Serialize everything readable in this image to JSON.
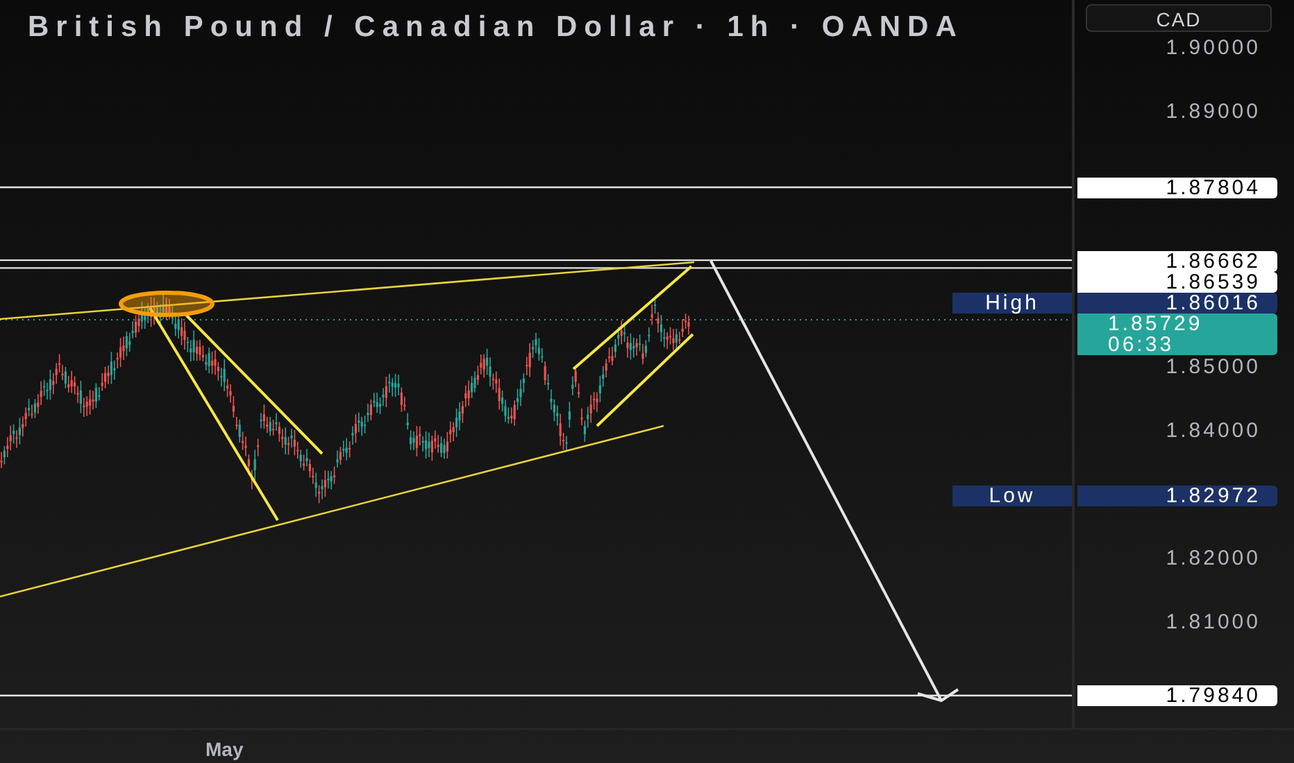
{
  "title": "British Pound / Canadian Dollar · 1h · OANDA",
  "currency_button": "CAD",
  "price_ticks": [
    "1.90000",
    "1.89000",
    "1.85000",
    "1.84000",
    "1.82000",
    "1.81000"
  ],
  "price_tags": [
    {
      "kind": "level",
      "price": "1.87804"
    },
    {
      "kind": "level",
      "price": "1.86662"
    },
    {
      "kind": "level",
      "price": "1.86539"
    },
    {
      "kind": "high",
      "label": "High",
      "price": "1.86016"
    },
    {
      "kind": "current",
      "price": "1.85729",
      "countdown": "06:33"
    },
    {
      "kind": "low",
      "label": "Low",
      "price": "1.82972"
    },
    {
      "kind": "level",
      "price": "1.79840"
    }
  ],
  "time_axis": [
    "May"
  ]
}
